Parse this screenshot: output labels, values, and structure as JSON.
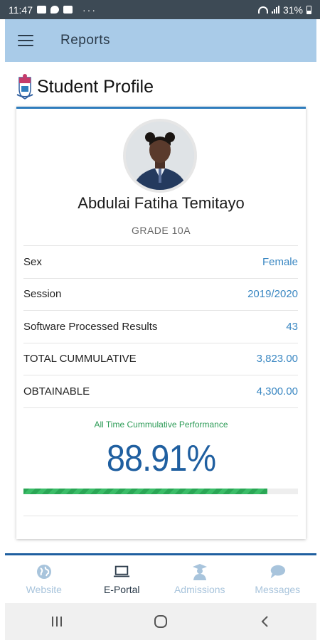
{
  "status_bar": {
    "time": "11:47",
    "battery": "31%",
    "dots": "···"
  },
  "app_bar": {
    "title": "Reports"
  },
  "page": {
    "title": "Student Profile"
  },
  "student": {
    "name": "Abdulai Fatiha Temitayo",
    "grade": "GRADE 10A"
  },
  "info": [
    {
      "label": "Sex",
      "value": "Female"
    },
    {
      "label": "Session",
      "value": "2019/2020"
    },
    {
      "label": "Software Processed Results",
      "value": "43"
    },
    {
      "label": "TOTAL CUMMULATIVE",
      "value": "3,823.00"
    },
    {
      "label": "OBTAINABLE",
      "value": "4,300.00"
    }
  ],
  "performance": {
    "label": "All Time Cummulative Performance",
    "value": "88.91%",
    "fraction": 0.8891
  },
  "tabs": [
    {
      "label": "Website",
      "icon": "globe-icon",
      "active": false
    },
    {
      "label": "E-Portal",
      "icon": "laptop-icon",
      "active": true
    },
    {
      "label": "Admissions",
      "icon": "graduate-icon",
      "active": false
    },
    {
      "label": "Messages",
      "icon": "chat-bubbles-icon",
      "active": false
    }
  ],
  "colors": {
    "app_bar": "#a9cbe8",
    "accent_blue": "#1f5fa0",
    "value_blue": "#3a87c2",
    "progress_green": "#2aa655"
  }
}
